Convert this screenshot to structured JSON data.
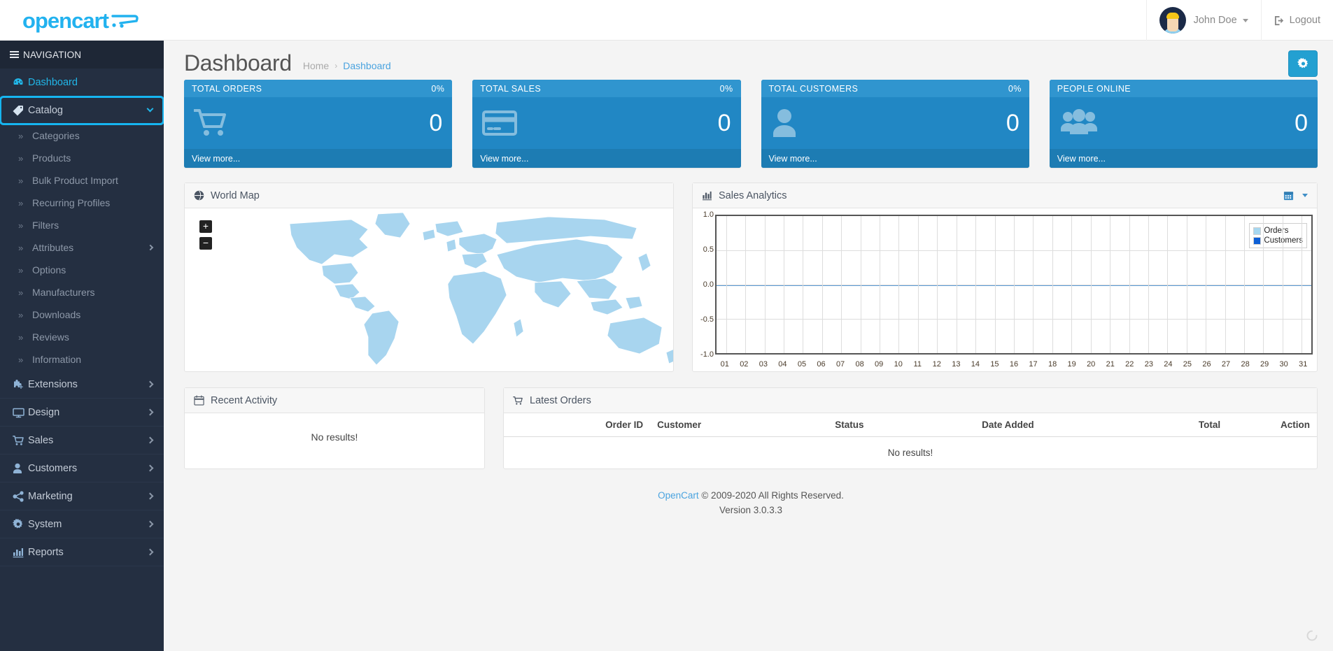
{
  "header": {
    "logo": "opencart",
    "user_name": "John Doe",
    "logout_label": "Logout"
  },
  "sidebar": {
    "nav_title": "NAVIGATION",
    "items": [
      {
        "label": "Dashboard",
        "icon": "dashboard-icon",
        "state": "active"
      },
      {
        "label": "Catalog",
        "icon": "tag-icon",
        "state": "expanded-highlight"
      },
      {
        "label": "Extensions",
        "icon": "puzzle-icon",
        "state": "collapsed"
      },
      {
        "label": "Design",
        "icon": "monitor-icon",
        "state": "collapsed"
      },
      {
        "label": "Sales",
        "icon": "cart-icon",
        "state": "collapsed"
      },
      {
        "label": "Customers",
        "icon": "user-icon",
        "state": "collapsed"
      },
      {
        "label": "Marketing",
        "icon": "share-icon",
        "state": "collapsed"
      },
      {
        "label": "System",
        "icon": "gear-icon",
        "state": "collapsed"
      },
      {
        "label": "Reports",
        "icon": "bar-chart-icon",
        "state": "collapsed"
      }
    ],
    "catalog_children": [
      {
        "label": "Categories",
        "has_children": false
      },
      {
        "label": "Products",
        "has_children": false
      },
      {
        "label": "Bulk Product Import",
        "has_children": false
      },
      {
        "label": "Recurring Profiles",
        "has_children": false
      },
      {
        "label": "Filters",
        "has_children": false
      },
      {
        "label": "Attributes",
        "has_children": true
      },
      {
        "label": "Options",
        "has_children": false
      },
      {
        "label": "Manufacturers",
        "has_children": false
      },
      {
        "label": "Downloads",
        "has_children": false
      },
      {
        "label": "Reviews",
        "has_children": false
      },
      {
        "label": "Information",
        "has_children": false
      }
    ]
  },
  "page": {
    "title": "Dashboard",
    "breadcrumb": [
      {
        "label": "Home",
        "current": false
      },
      {
        "label": "Dashboard",
        "current": true
      }
    ]
  },
  "cards": [
    {
      "title": "TOTAL ORDERS",
      "percent": "0%",
      "value": "0",
      "link": "View more...",
      "icon": "shopping-cart-icon"
    },
    {
      "title": "TOTAL SALES",
      "percent": "0%",
      "value": "0",
      "link": "View more...",
      "icon": "credit-card-icon"
    },
    {
      "title": "TOTAL CUSTOMERS",
      "percent": "0%",
      "value": "0",
      "link": "View more...",
      "icon": "person-icon"
    },
    {
      "title": "PEOPLE ONLINE",
      "percent": "",
      "value": "0",
      "link": "View more...",
      "icon": "people-group-icon"
    }
  ],
  "world_map": {
    "title": "World Map",
    "zoom_in": "+",
    "zoom_out": "−"
  },
  "analytics": {
    "title": "Sales Analytics",
    "range_icon": "calendar-icon"
  },
  "chart_data": {
    "type": "line",
    "title": "Sales Analytics",
    "xlabel": "",
    "ylabel": "",
    "x": [
      "01",
      "02",
      "03",
      "04",
      "05",
      "06",
      "07",
      "08",
      "09",
      "10",
      "11",
      "12",
      "13",
      "14",
      "15",
      "16",
      "17",
      "18",
      "19",
      "20",
      "21",
      "22",
      "23",
      "24",
      "25",
      "26",
      "27",
      "28",
      "29",
      "30",
      "31"
    ],
    "yticks": [
      "1.0",
      "0.5",
      "0.0",
      "-0.5",
      "-1.0"
    ],
    "ylim": [
      -1.0,
      1.0
    ],
    "grid": true,
    "legend_position": "top-right",
    "series": [
      {
        "name": "Orders",
        "color": "#a6d7f0",
        "values": [
          0,
          0,
          0,
          0,
          0,
          0,
          0,
          0,
          0,
          0,
          0,
          0,
          0,
          0,
          0,
          0,
          0,
          0,
          0,
          0,
          0,
          0,
          0,
          0,
          0,
          0,
          0,
          0,
          0,
          0,
          0
        ]
      },
      {
        "name": "Customers",
        "color": "#0d5fd6",
        "values": [
          0,
          0,
          0,
          0,
          0,
          0,
          0,
          0,
          0,
          0,
          0,
          0,
          0,
          0,
          0,
          0,
          0,
          0,
          0,
          0,
          0,
          0,
          0,
          0,
          0,
          0,
          0,
          0,
          0,
          0,
          0
        ]
      }
    ]
  },
  "recent_activity": {
    "title": "Recent Activity",
    "empty_text": "No results!"
  },
  "latest_orders": {
    "title": "Latest Orders",
    "columns": [
      "Order ID",
      "Customer",
      "Status",
      "Date Added",
      "Total",
      "Action"
    ],
    "rows": [],
    "empty_text": "No results!"
  },
  "footer": {
    "link_label": "OpenCart",
    "copyright": "© 2009-2020 All Rights Reserved.",
    "version": "Version 3.0.3.3"
  },
  "colors": {
    "brand": "#22b2ef",
    "card_bg": "#2187c4",
    "card_head": "#3095cf",
    "card_foot": "#1d7cb3",
    "sidebar_bg": "#242f41",
    "highlight": "#16b5f0",
    "map_land": "#a8d5ef"
  }
}
